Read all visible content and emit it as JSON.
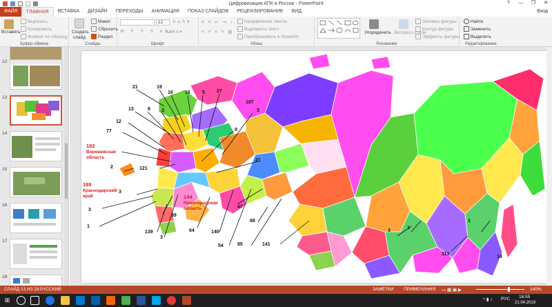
{
  "window": {
    "title": "Цифровизация АПК в России - PowerPoint",
    "controls": [
      "?",
      "—",
      "❐",
      "✕"
    ],
    "login": "Вход"
  },
  "tabs": [
    "ФАЙЛ",
    "ГЛАВНАЯ",
    "ВСТАВКА",
    "ДИЗАЙН",
    "ПЕРЕХОДЫ",
    "АНИМАЦИЯ",
    "ПОКАЗ СЛАЙДОВ",
    "РЕЦЕНЗИРОВАНИЕ",
    "ВИД"
  ],
  "ribbon": {
    "clipboard": {
      "paste": "Вставить",
      "cut": "Вырезать",
      "copy": "Копировать",
      "format": "Формат по образцу",
      "label": "Буфер обмена"
    },
    "slides": {
      "create": "Создать",
      "create2": "слайд",
      "layout": "Макет",
      "reset": "Сбросить",
      "section": "Раздел",
      "label": "Слайды"
    },
    "font": {
      "size": "12",
      "label": "Шрифт"
    },
    "paragraph": {
      "direction": "Направление текста",
      "align": "Выровнять текст",
      "smartart": "Преобразовать в SmartArt",
      "label": "Абзац"
    },
    "drawing": {
      "arrange": "Упорядочить",
      "quickstyles": "Экспресс-стили",
      "fill": "Заливка фигуры",
      "outline": "Контур фигуры",
      "effects": "Эффекты фигуры",
      "label": "Рисование"
    },
    "editing": {
      "find": "Найти",
      "replace": "Заменить",
      "select": "Выделить",
      "label": "Редактирование"
    }
  },
  "thumbnails": [
    {
      "num": "12",
      "selected": false
    },
    {
      "num": "13",
      "selected": true
    },
    {
      "num": "14",
      "selected": false
    },
    {
      "num": "15",
      "selected": false
    },
    {
      "num": "16",
      "selected": false
    },
    {
      "num": "17",
      "selected": false
    },
    {
      "num": "18",
      "selected": false
    }
  ],
  "map": {
    "numbers": [
      "21",
      "19",
      "16",
      "16",
      "5",
      "27",
      "107",
      "13",
      "9",
      "3",
      "3",
      "12",
      "77",
      "8",
      "182",
      "2",
      "121",
      "21",
      "189",
      "3",
      "144",
      "47",
      "3",
      "1",
      "39",
      "139",
      "3",
      "64",
      "140",
      "54",
      "85",
      "68",
      "141",
      "3",
      "1",
      "1",
      "113",
      "14"
    ],
    "red_labels": {
      "voronezh": "Воронежская",
      "voronezh2": "область",
      "krasnodar": "Краснодарский",
      "krasnodar2": "край",
      "nizhny": "Нижегородская",
      "nizhny2": "область"
    }
  },
  "status": {
    "slide": "СЛАЙД 13 ИЗ 28",
    "lang": "РУССКИЙ",
    "notes": "ЗАМЕТКИ",
    "comments": "ПРИМЕЧАНИЯ",
    "zoom": "140%"
  },
  "taskbar": {
    "time": "16:55",
    "date": "21.04.2019",
    "lang": "РУС"
  }
}
